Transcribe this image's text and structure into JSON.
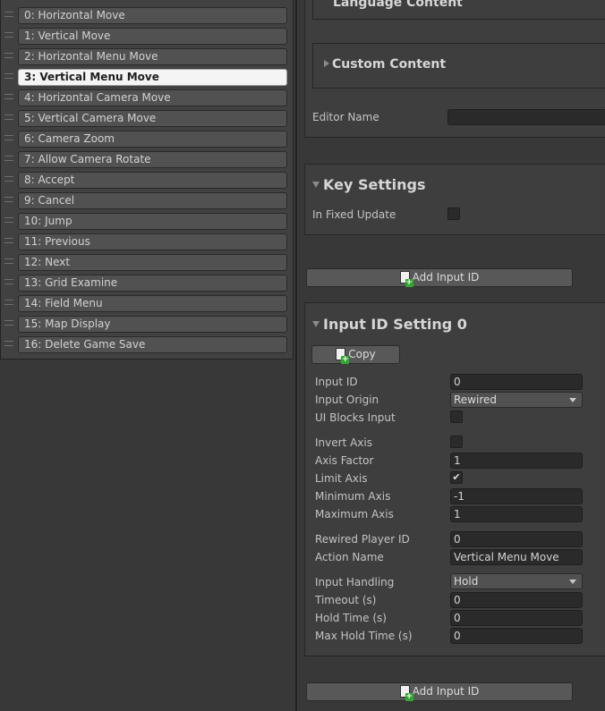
{
  "input_list": {
    "items": [
      {
        "label": "0: Horizontal Move",
        "selected": false
      },
      {
        "label": "1: Vertical Move",
        "selected": false
      },
      {
        "label": "2: Horizontal Menu Move",
        "selected": false
      },
      {
        "label": "3: Vertical Menu Move",
        "selected": true
      },
      {
        "label": "4: Horizontal Camera Move",
        "selected": false
      },
      {
        "label": "5: Vertical Camera Move",
        "selected": false
      },
      {
        "label": "6: Camera Zoom",
        "selected": false
      },
      {
        "label": "7: Allow Camera Rotate",
        "selected": false
      },
      {
        "label": "8: Accept",
        "selected": false
      },
      {
        "label": "9: Cancel",
        "selected": false
      },
      {
        "label": "10: Jump",
        "selected": false
      },
      {
        "label": "11: Previous",
        "selected": false
      },
      {
        "label": "12: Next",
        "selected": false
      },
      {
        "label": "13: Grid Examine",
        "selected": false
      },
      {
        "label": "14: Field Menu",
        "selected": false
      },
      {
        "label": "15: Map Display",
        "selected": false
      },
      {
        "label": "16: Delete Game Save",
        "selected": false
      }
    ]
  },
  "content_box": {
    "language_content_title": "Language Content",
    "custom_content_title": "Custom Content",
    "editor_name_label": "Editor Name",
    "editor_name_value": ""
  },
  "key_settings": {
    "title": "Key Settings",
    "in_fixed_update_label": "In Fixed Update",
    "in_fixed_update_checked": false
  },
  "add_input_id_label": "Add Input ID",
  "input_id_setting": {
    "title": "Input ID Setting 0",
    "copy_label": "Copy",
    "input_id_label": "Input ID",
    "input_id_value": "0",
    "input_origin_label": "Input Origin",
    "input_origin_value": "Rewired",
    "ui_blocks_input_label": "UI Blocks Input",
    "ui_blocks_input_checked": false,
    "invert_axis_label": "Invert Axis",
    "invert_axis_checked": false,
    "axis_factor_label": "Axis Factor",
    "axis_factor_value": "1",
    "limit_axis_label": "Limit Axis",
    "limit_axis_checked": true,
    "check_mark": "✔",
    "minimum_axis_label": "Minimum Axis",
    "minimum_axis_value": "-1",
    "maximum_axis_label": "Maximum Axis",
    "maximum_axis_value": "1",
    "rewired_player_id_label": "Rewired Player ID",
    "rewired_player_id_value": "0",
    "action_name_label": "Action Name",
    "action_name_value": "Vertical Menu Move",
    "input_handling_label": "Input Handling",
    "input_handling_value": "Hold",
    "timeout_label": "Timeout (s)",
    "timeout_value": "0",
    "hold_time_label": "Hold Time (s)",
    "hold_time_value": "0",
    "max_hold_time_label": "Max Hold Time (s)",
    "max_hold_time_value": "0"
  }
}
